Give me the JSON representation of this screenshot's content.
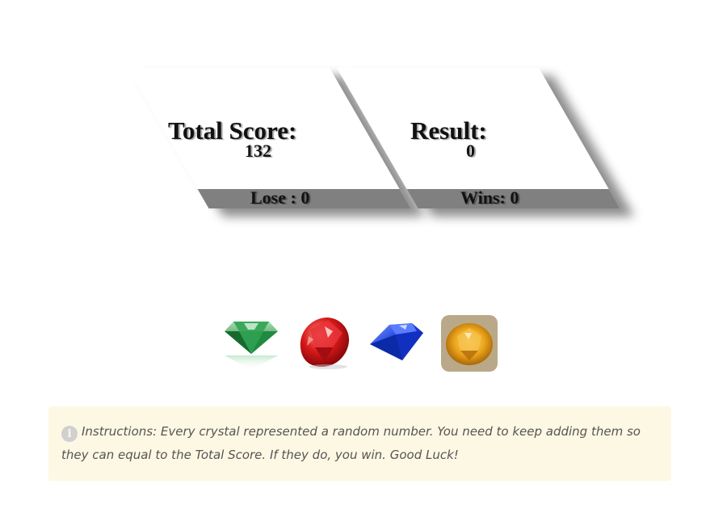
{
  "scoreboard": {
    "total_score_label": "Total Score:",
    "total_score_value": "132",
    "losses_label": "Lose : 0",
    "result_label": "Result:",
    "result_value": "0",
    "wins_label": "Wins: 0"
  },
  "crystals": [
    {
      "name": "emerald",
      "color": "#1e8a3a"
    },
    {
      "name": "ruby",
      "color": "#d1181b"
    },
    {
      "name": "sapphire",
      "color": "#1436d6"
    },
    {
      "name": "topaz",
      "color": "#e69a0a"
    }
  ],
  "instructions": {
    "icon": "info-icon",
    "text": "Instructions: Every crystal represented a random number. You need to keep adding them so they can equal to the Total Score. If they do, you win. Good Luck!"
  }
}
